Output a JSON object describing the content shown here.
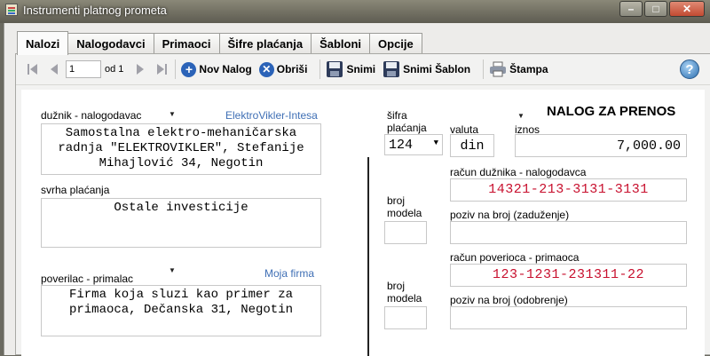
{
  "window": {
    "title": "Instrumenti platnog prometa"
  },
  "tabs": [
    {
      "label": "Nalozi"
    },
    {
      "label": "Nalogodavci"
    },
    {
      "label": "Primaoci"
    },
    {
      "label": "Šifre plaćanja"
    },
    {
      "label": "Šabloni"
    },
    {
      "label": "Opcije"
    }
  ],
  "toolbar": {
    "page_value": "1",
    "of_label": "od 1",
    "new_label": "Nov Nalog",
    "delete_label": "Obriši",
    "save_label": "Snimi",
    "save_template_label": "Snimi Šablon",
    "print_label": "Štampa",
    "help_label": "?"
  },
  "form": {
    "heading": "NALOG ZA PRENOS",
    "payer": {
      "label": "dužnik - nalogodavac",
      "link": "ElektroVikler-Intesa",
      "text": "Samostalna elektro-mehaničarska\nradnja \"ELEKTROVIKLER\", Stefanije\nMihajlović 34, Negotin"
    },
    "purpose": {
      "label": "svrha plaćanja",
      "text": "Ostale investicije"
    },
    "recipient": {
      "label": "poverilac - primalac",
      "link": "Moja firma",
      "text": "Firma koja sluzi kao primer za\nprimaoca, Dečanska 31, Negotin"
    },
    "payment_code": {
      "label_line1": "šifra",
      "label_line2": "plaćanja",
      "value": "124"
    },
    "currency": {
      "label": "valuta",
      "value": "din"
    },
    "amount": {
      "label": "iznos",
      "value": "7,000.00"
    },
    "payer_account": {
      "label": "račun dužnika - nalogodavca",
      "value": "14321-213-3131-3131"
    },
    "model_debit": {
      "label_line1": "broj",
      "label_line2": "modela",
      "value": ""
    },
    "reference_debit": {
      "label": "poziv na broj (zaduženje)",
      "value": ""
    },
    "recipient_account": {
      "label": "račun poverioca - primaoca",
      "value": "123-1231-231311-22"
    },
    "model_credit": {
      "label_line1": "broj",
      "label_line2": "modela",
      "value": ""
    },
    "reference_credit": {
      "label": "poziv na broj (odobrenje)",
      "value": ""
    }
  },
  "colors": {
    "account_text": "#c8102e",
    "link": "#3f6fb5"
  }
}
